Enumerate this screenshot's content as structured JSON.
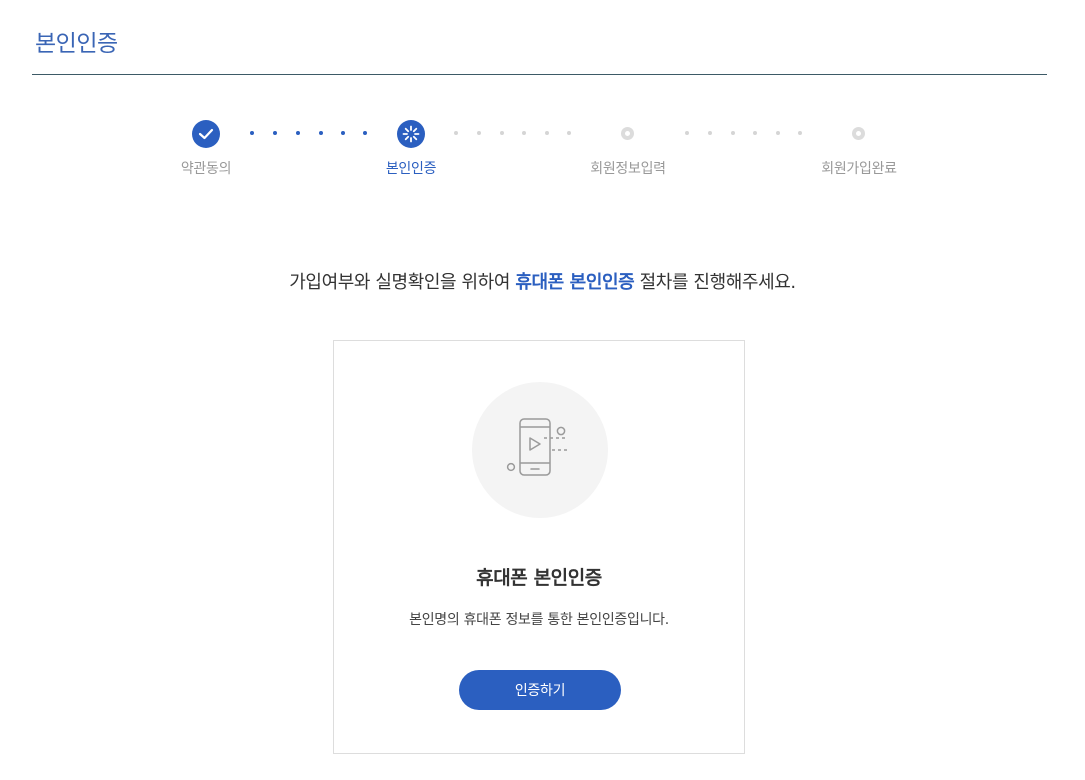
{
  "page": {
    "title": "본인인증"
  },
  "stepper": {
    "steps": [
      {
        "label": "약관동의",
        "state": "done",
        "icon": "check-icon"
      },
      {
        "label": "본인인증",
        "state": "current",
        "icon": "loading-spinner-icon"
      },
      {
        "label": "회원정보입력",
        "state": "pending",
        "icon": "circle-icon"
      },
      {
        "label": "회원가입완료",
        "state": "pending",
        "icon": "circle-icon"
      }
    ]
  },
  "intro": {
    "before": "가입여부와 실명확인을 위하여 ",
    "highlight": "휴대폰 본인인증",
    "after": " 절차를 진행해주세요."
  },
  "card": {
    "icon": "mobile-phone-icon",
    "title": "휴대폰 본인인증",
    "description": "본인명의 휴대폰 정보를 통한 본인인증입니다.",
    "button_label": "인증하기"
  },
  "colors": {
    "accent": "#2b5fc0",
    "title": "#3a65b5",
    "rule": "#3d5a66",
    "pending": "#d5d5d5"
  }
}
